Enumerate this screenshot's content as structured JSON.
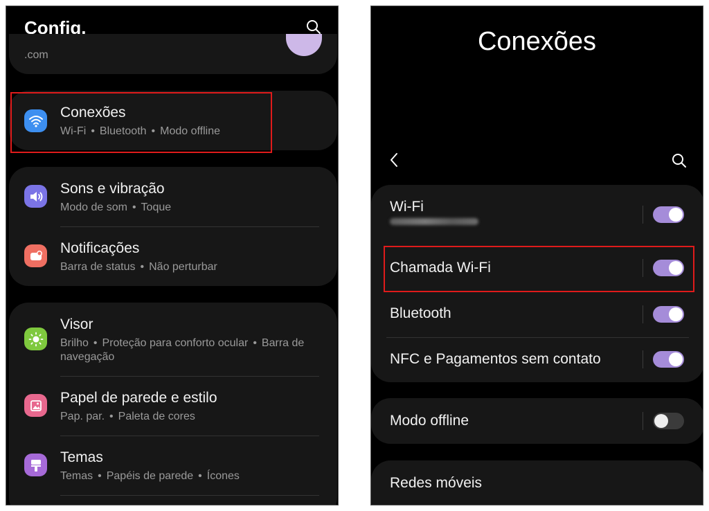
{
  "left": {
    "header_title": "Config.",
    "account_email_fragment": ".com",
    "groups": [
      {
        "items": [
          {
            "title": "Conexões",
            "subtitle": [
              "Wi-Fi",
              "Bluetooth",
              "Modo offline"
            ],
            "icon": "wifi-icon",
            "icon_color": "#3d8ff0"
          }
        ]
      },
      {
        "items": [
          {
            "title": "Sons e vibração",
            "subtitle": [
              "Modo de som",
              "Toque"
            ],
            "icon": "volume-icon",
            "icon_color": "#7b74e6"
          },
          {
            "title": "Notificações",
            "subtitle": [
              "Barra de status",
              "Não perturbar"
            ],
            "icon": "notification-icon",
            "icon_color": "#ef6f62"
          }
        ]
      },
      {
        "items": [
          {
            "title": "Visor",
            "subtitle": [
              "Brilho",
              "Proteção para conforto ocular",
              "Barra de"
            ],
            "subtitle_line2": "navegação",
            "icon": "brightness-icon",
            "icon_color": "#7fc93e"
          },
          {
            "title": "Papel de parede e estilo",
            "subtitle": [
              "Pap. par.",
              "Paleta de cores"
            ],
            "icon": "wallpaper-icon",
            "icon_color": "#e8688e"
          },
          {
            "title": "Temas",
            "subtitle": [
              "Temas",
              "Papéis de parede",
              "Ícones"
            ],
            "icon": "themes-icon",
            "icon_color": "#a66ad8"
          }
        ]
      }
    ]
  },
  "right": {
    "big_title": "Conexões",
    "groups": [
      {
        "items": [
          {
            "title": "Wi-Fi",
            "toggle": true
          },
          {
            "title": "Chamada Wi-Fi",
            "toggle": true
          },
          {
            "title": "Bluetooth",
            "toggle": true
          },
          {
            "title": "NFC e Pagamentos sem contato",
            "toggle": true
          }
        ]
      },
      {
        "items": [
          {
            "title": "Modo offline",
            "toggle": false
          }
        ]
      },
      {
        "items": [
          {
            "title": "Redes móveis"
          }
        ]
      }
    ]
  },
  "colors": {
    "toggle_on": "#a58cd9",
    "highlight": "#e01b1b",
    "card_bg": "#171717"
  }
}
